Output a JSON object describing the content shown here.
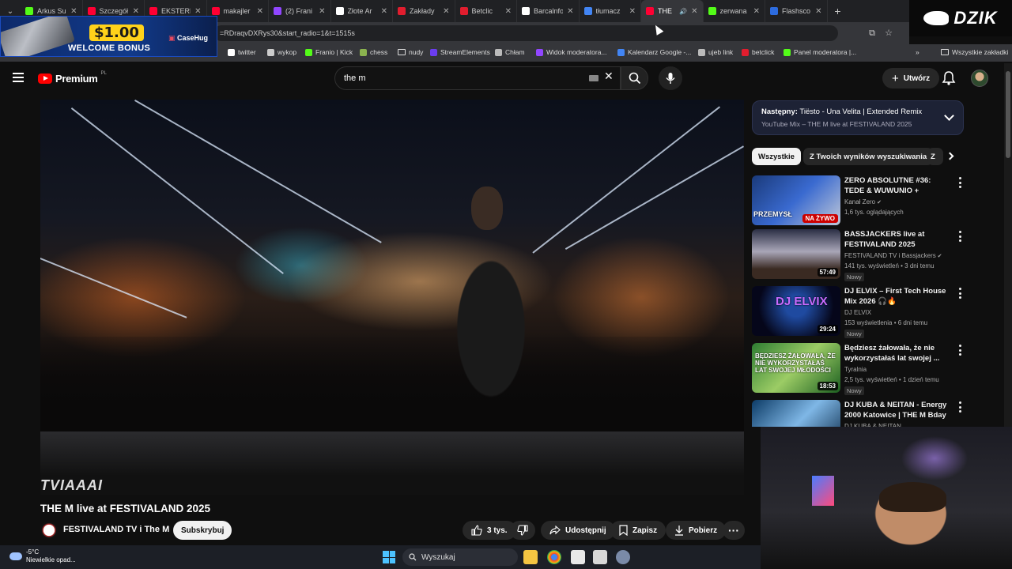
{
  "browser": {
    "tabs": [
      {
        "title": "Arkus Su",
        "favicon_color": "#53fc18"
      },
      {
        "title": "Szczegół",
        "favicon_color": "#ff0033"
      },
      {
        "title": "EKSTERM",
        "favicon_color": "#ff0033"
      },
      {
        "title": "makajler",
        "favicon_color": "#ff0033"
      },
      {
        "title": "(2) Frani",
        "favicon_color": "#9146ff"
      },
      {
        "title": "Złote Ar",
        "favicon_color": "#ffffff"
      },
      {
        "title": "Zakłady",
        "favicon_color": "#e11d2e"
      },
      {
        "title": "Betclic",
        "favicon_color": "#e11d2e"
      },
      {
        "title": "Barcalnfo",
        "favicon_color": "#ffffff"
      },
      {
        "title": "tłumacz",
        "favicon_color": "#4285f4"
      },
      {
        "title": "THE",
        "favicon_color": "#ff0033",
        "active": true
      },
      {
        "title": "zerwana",
        "favicon_color": "#53fc18"
      },
      {
        "title": "Flashsco",
        "favicon_color": "#2d6cdf"
      }
    ],
    "new_tab_label": "+",
    "url": "=RDraqvDXRys30&start_radio=1&t=1515s",
    "bookmarks": [
      {
        "label": "twitter",
        "icon": "x-icon"
      },
      {
        "label": "wykop",
        "icon": "wykop-icon"
      },
      {
        "label": "Franio | Kick",
        "icon": "kick-icon"
      },
      {
        "label": "chess",
        "icon": "chess-icon"
      },
      {
        "label": "nudy",
        "icon": "folder-icon"
      },
      {
        "label": "StreamElements",
        "icon": "streamelements-icon"
      },
      {
        "label": "Chłam",
        "icon": "globe-icon"
      },
      {
        "label": "Widok moderatora...",
        "icon": "twitch-icon"
      },
      {
        "label": "Kalendarz Google -...",
        "icon": "calendar-icon"
      },
      {
        "label": "ujeb link",
        "icon": "globe-icon"
      },
      {
        "label": "betclick",
        "icon": "betclic-icon"
      },
      {
        "label": "Panel moderatora |...",
        "icon": "kick-icon"
      }
    ],
    "bookmarks_more": "»",
    "all_bookmarks_label": "Wszystkie zakładki"
  },
  "overlays": {
    "promo_amount": "$1.00",
    "promo_text": "WELCOME BONUS",
    "promo_brand": "CaseHug",
    "dzik_logo": "DZIK"
  },
  "youtube": {
    "logo_word": "Premium",
    "region": "PL",
    "search_value": "the m",
    "create_label": "Utwórz",
    "video": {
      "title": "THE M live at FESTIVALAND 2025",
      "watermark": "TVIAAAI",
      "channel": "FESTIVALAND TV i The M",
      "subscribe_label": "Subskrybuj",
      "likes": "3 tys.",
      "share_label": "Udostępnij",
      "save_label": "Zapisz",
      "download_label": "Pobierz"
    },
    "next_up": {
      "prefix": "Następny:",
      "title": "Tiësto - Una Velita | Extended Remix",
      "subtitle": "YouTube Mix – THE M live at FESTIVALAND 2025"
    },
    "chips": [
      "Wszystkie",
      "Z Twoich wyników wyszukiwania",
      "Z"
    ],
    "recommendations": [
      {
        "title": "ZERO ABSOLUTNE #36: TEDE & WUWUNIO + PRZEMYSŁAW ...",
        "channel": "Kanał Zero",
        "verified": true,
        "meta": "1,6 tys. oglądających",
        "badge": "",
        "live_label": "NA ŻYWO",
        "thumb_text": "PRZEMYSŁ",
        "duration": ""
      },
      {
        "title": "BASSJACKERS live at FESTIVALAND 2025",
        "channel": "FESTIVALAND TV i Bassjackers",
        "verified": true,
        "meta": "141 tys. wyświetleń • 3 dni temu",
        "badge": "Nowy",
        "duration": "57:49"
      },
      {
        "title": "DJ ELVIX – First Tech House Mix 2026 🎧🔥",
        "channel": "DJ ELVIX",
        "verified": false,
        "meta": "153 wyświetlenia • 6 dni temu",
        "badge": "Nowy",
        "duration": "29:24",
        "thumb_text": "DJ ELVIX"
      },
      {
        "title": "Będziesz żałowała, że nie wykorzystałaś lat swojej ...",
        "channel": "Tyralnia",
        "verified": false,
        "meta": "2,5 tys. wyświetleń • 1 dzień temu",
        "badge": "Nowy",
        "duration": "18:53",
        "thumb_text": "BĘDZIESZ ŻAŁOWAŁA, ŻE NIE WYKORZYSTAŁAŚ LAT SWOJEJ MŁODOŚCI"
      },
      {
        "title": "DJ KUBA & NEITAN - Energy 2000 Katowice | THE M Bday ...",
        "channel": "DJ KUBA & NEITAN",
        "verified": false,
        "meta": "",
        "badge": "",
        "duration": ""
      }
    ]
  },
  "taskbar": {
    "temperature": "-5°C",
    "weather_desc": "Niewielkie opad...",
    "search_placeholder": "Wyszukaj"
  }
}
